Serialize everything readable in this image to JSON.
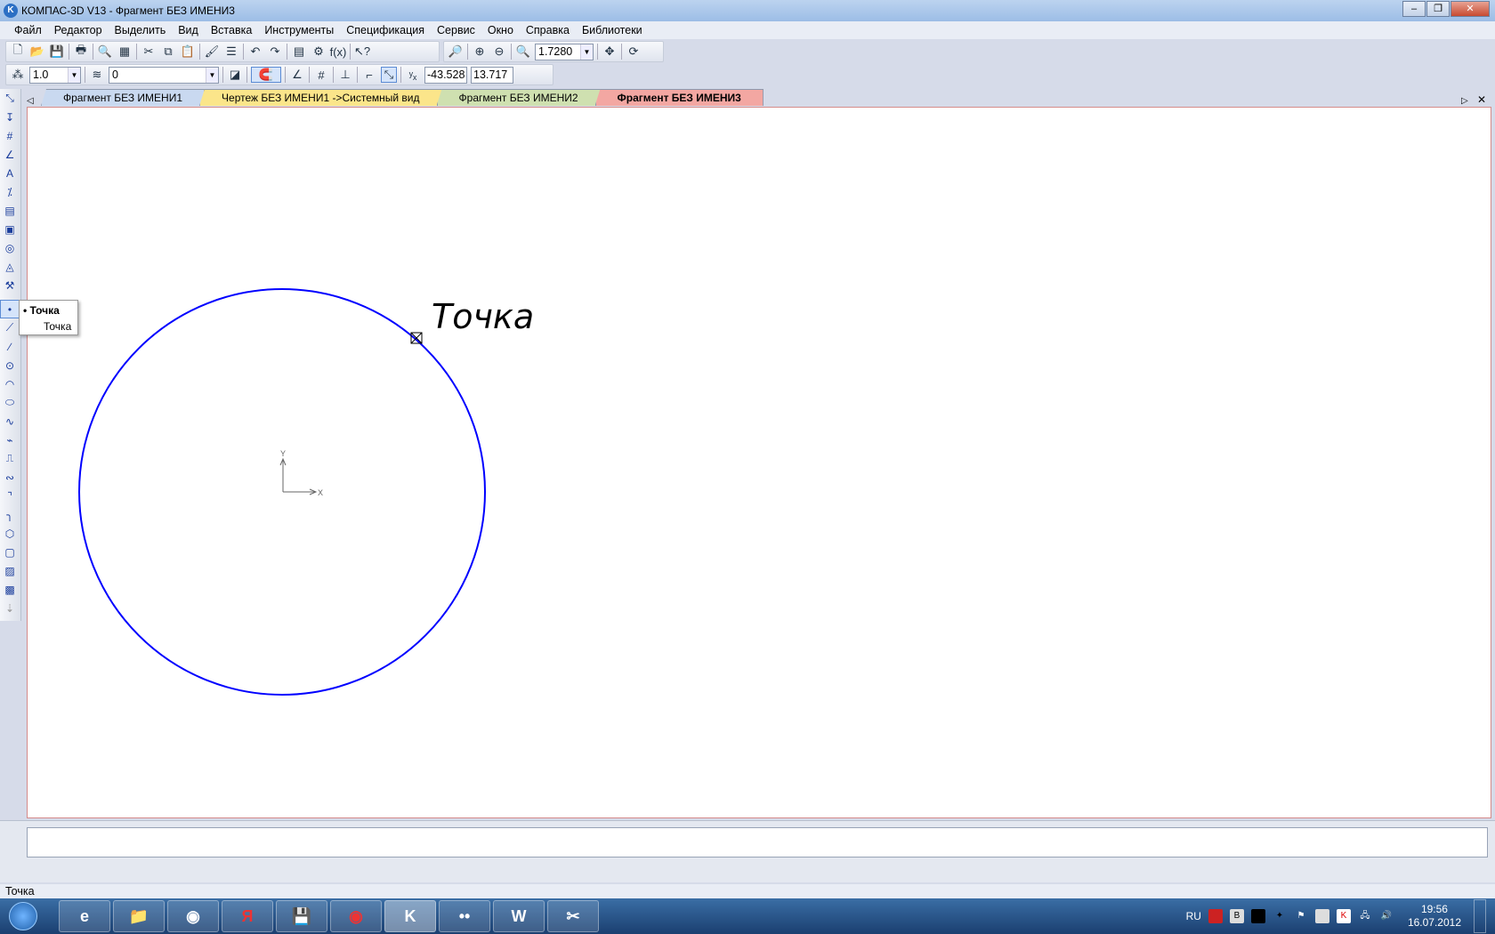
{
  "window": {
    "title": "КОМПАС-3D V13 - Фрагмент БЕЗ ИМЕНИ3",
    "minimize": "–",
    "maximize": "❐",
    "close": "✕"
  },
  "menu": [
    "Файл",
    "Редактор",
    "Выделить",
    "Вид",
    "Вставка",
    "Инструменты",
    "Спецификация",
    "Сервис",
    "Окно",
    "Справка",
    "Библиотеки"
  ],
  "toolbar": {
    "zoom_value": "1.7280",
    "step_value": "1.0",
    "layer_value": "0",
    "coord_x": "-43.528",
    "coord_y": "13.717"
  },
  "tabs": [
    {
      "label": "Фрагмент БЕЗ ИМЕНИ1",
      "color": "#c9d9f0"
    },
    {
      "label": "Чертеж БЕЗ ИМЕНИ1 ->Системный вид",
      "color": "#fbe58a"
    },
    {
      "label": "Фрагмент БЕЗ ИМЕНИ2",
      "color": "#cfe0b0"
    },
    {
      "label": "Фрагмент БЕЗ ИМЕНИ3",
      "color": "#f3a7a2"
    }
  ],
  "canvas": {
    "point_label": "Точка",
    "axis_x": "X",
    "axis_y": "Y",
    "curve_color": "#0000ff"
  },
  "popup": {
    "items": [
      "Точка",
      "Точка"
    ]
  },
  "status": "Точка",
  "taskbar": {
    "lang": "RU",
    "time": "19:56",
    "date": "16.07.2012",
    "apps": [
      "e",
      "📁",
      "◉",
      "Я",
      "💾",
      "◉",
      "K",
      "••",
      "W",
      "✂"
    ]
  }
}
